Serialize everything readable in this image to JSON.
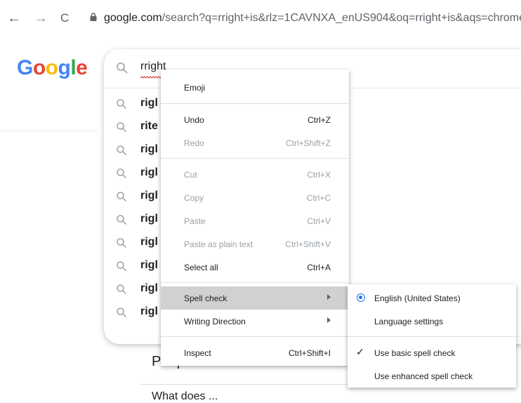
{
  "browser": {
    "back_icon": "←",
    "forward_icon": "→",
    "reload_icon": "C",
    "url_host": "google.com",
    "url_path": "/search?q=rright+is&rlz=1CAVNXA_enUS904&oq=rright+is&aqs=chrome"
  },
  "google": {
    "logo": "Google",
    "logo_colors": [
      "#4285F4",
      "#EA4335",
      "#FBBC05",
      "#4285F4",
      "#34A853",
      "#EA4335"
    ]
  },
  "search": {
    "query": "rright",
    "suggestions": [
      "rigl",
      "rite",
      "rigl",
      "rigl",
      "rigl",
      "rigl",
      "rigl",
      "rigl",
      "rigl",
      "rigl"
    ]
  },
  "results": {
    "people_also_ask": "People also ask",
    "bottom_text": "What does ... "
  },
  "context_menu": {
    "emoji": "Emoji",
    "undo": {
      "label": "Undo",
      "shortcut": "Ctrl+Z"
    },
    "redo": {
      "label": "Redo",
      "shortcut": "Ctrl+Shift+Z"
    },
    "cut": {
      "label": "Cut",
      "shortcut": "Ctrl+X"
    },
    "copy": {
      "label": "Copy",
      "shortcut": "Ctrl+C"
    },
    "paste": {
      "label": "Paste",
      "shortcut": "Ctrl+V"
    },
    "paste_plain": {
      "label": "Paste as plain text",
      "shortcut": "Ctrl+Shift+V"
    },
    "select_all": {
      "label": "Select all",
      "shortcut": "Ctrl+A"
    },
    "spell_check": "Spell check",
    "writing_direction": "Writing Direction",
    "inspect": {
      "label": "Inspect",
      "shortcut": "Ctrl+Shift+I"
    }
  },
  "spell_submenu": {
    "english": "English (United States)",
    "language_settings": "Language settings",
    "basic": "Use basic spell check",
    "enhanced": "Use enhanced spell check",
    "checked_icon": "✓"
  }
}
